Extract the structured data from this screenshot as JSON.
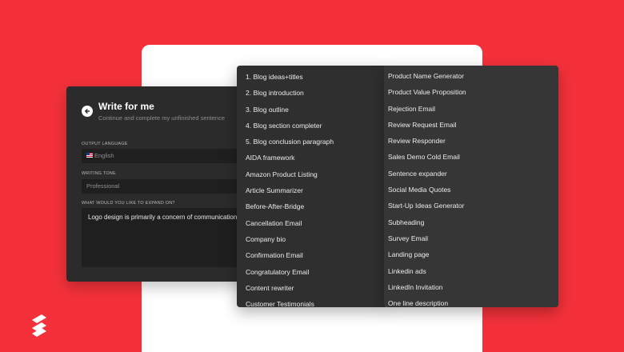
{
  "write_panel": {
    "title": "Write for me",
    "subtitle": "Continue and complete my unfinished sentence",
    "output_language_label": "OUTPUT LANGUAGE",
    "output_language_value": "English",
    "writing_tone_label": "WRITING TONE",
    "writing_tone_value": "Professional",
    "expand_label": "WHAT WOULD YOU LIKE TO EXPAND ON?",
    "expand_text": "Logo design is primarily a concern of communication."
  },
  "templates_left": [
    "1. Blog ideas+titles",
    "2. Blog introduction",
    "3. Blog outline",
    "4. Blog section completer",
    "5. Blog conclusion paragraph",
    "AIDA framework",
    "Amazon Product Listing",
    "Article Summarizer",
    "Before-After-Bridge",
    "Cancellation Email",
    "Company bio",
    "Confirmation Email",
    "Congratulatory Email",
    "Content rewriter",
    "Customer Testimonials"
  ],
  "templates_right": [
    "Product Name Generator",
    "Product Value Proposition",
    "Rejection Email",
    "Review Request Email",
    "Review Responder",
    "Sales Demo Cold Email",
    "Sentence expander",
    "Social Media Quotes",
    "Start-Up Ideas Generator",
    "Subheading",
    "Survey Email",
    "Landing page",
    "Linkedin ads",
    "LinkedIn Invitation",
    "One line description"
  ],
  "colors": {
    "background": "#f4313a",
    "panel": "#2b2b2b"
  },
  "icons": {
    "back": "arrow-left-icon",
    "logo": "brand-logo-icon"
  }
}
